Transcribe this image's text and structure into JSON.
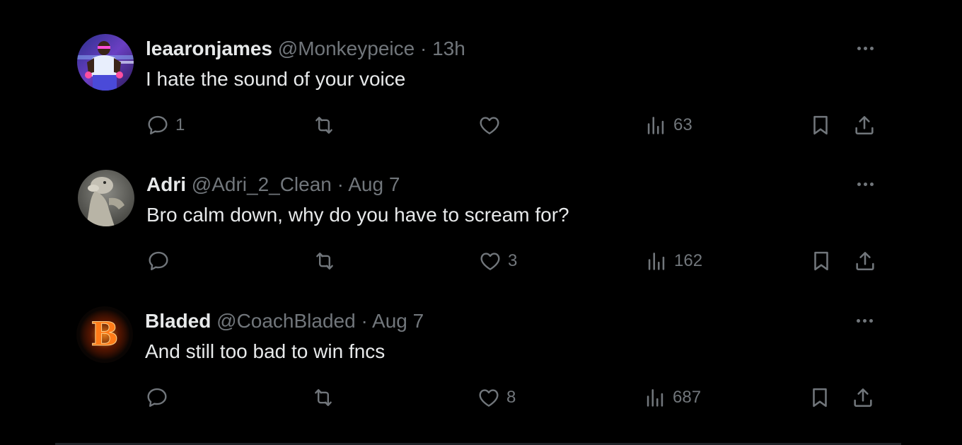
{
  "colors": {
    "background": "#000000",
    "text_primary": "#e7e9ea",
    "text_secondary": "#71767b"
  },
  "replies": [
    {
      "name": "leaaronjames",
      "handle": "@Monkeypeice",
      "separator": "·",
      "time": "13h",
      "text": "I hate the sound of your voice",
      "avatar": "athlete-photo-avatar",
      "actions": {
        "reply_count": "1",
        "repost_count": "",
        "like_count": "",
        "views_count": "63"
      }
    },
    {
      "name": "Adri",
      "handle": "@Adri_2_Clean",
      "separator": "·",
      "time": "Aug 7",
      "text": "Bro calm down, why do you have to scream for?",
      "avatar": "statue-photo-avatar",
      "actions": {
        "reply_count": "",
        "repost_count": "",
        "like_count": "3",
        "views_count": "162"
      }
    },
    {
      "name": "Bladed",
      "handle": "@CoachBladed",
      "separator": "·",
      "time": "Aug 7",
      "text": "And still too bad to win fncs",
      "avatar": "flaming-letter-avatar",
      "avatar_letter": "B",
      "actions": {
        "reply_count": "",
        "repost_count": "",
        "like_count": "8",
        "views_count": "687"
      }
    }
  ],
  "icons": {
    "reply": "reply-bubble-icon",
    "repost": "repost-arrows-icon",
    "like": "heart-icon",
    "views": "bar-chart-icon",
    "bookmark": "bookmark-icon",
    "share": "share-upload-icon",
    "more": "more-dots-icon"
  }
}
